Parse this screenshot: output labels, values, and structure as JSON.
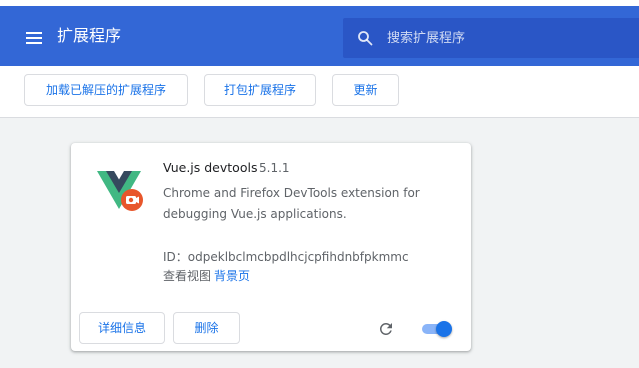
{
  "header": {
    "title": "扩展程序",
    "menu_icon": "menu-icon",
    "search": {
      "placeholder": "搜索扩展程序",
      "value": "",
      "icon": "search-icon"
    },
    "background_color": "#3367d6"
  },
  "toolbar": {
    "load_unpacked_label": "加载已解压的扩展程序",
    "pack_label": "打包扩展程序",
    "update_label": "更新"
  },
  "extension": {
    "name": "Vue.js devtools",
    "version": "5.1.1",
    "description": "Chrome and Firefox DevTools extension for debugging Vue.js applications.",
    "id_label": "ID：",
    "id": "odpeklbclmcbpdlhcjcpfihdnbfpkmmc",
    "views_label": "查看视图",
    "views_link": "背景页",
    "details_label": "详细信息",
    "remove_label": "删除",
    "icon": "vue-logo-icon",
    "enabled": true
  },
  "colors": {
    "accent": "#1a73e8",
    "vue_green": "#41b883",
    "vue_dark": "#35495e",
    "badge_red": "#e8562b"
  }
}
